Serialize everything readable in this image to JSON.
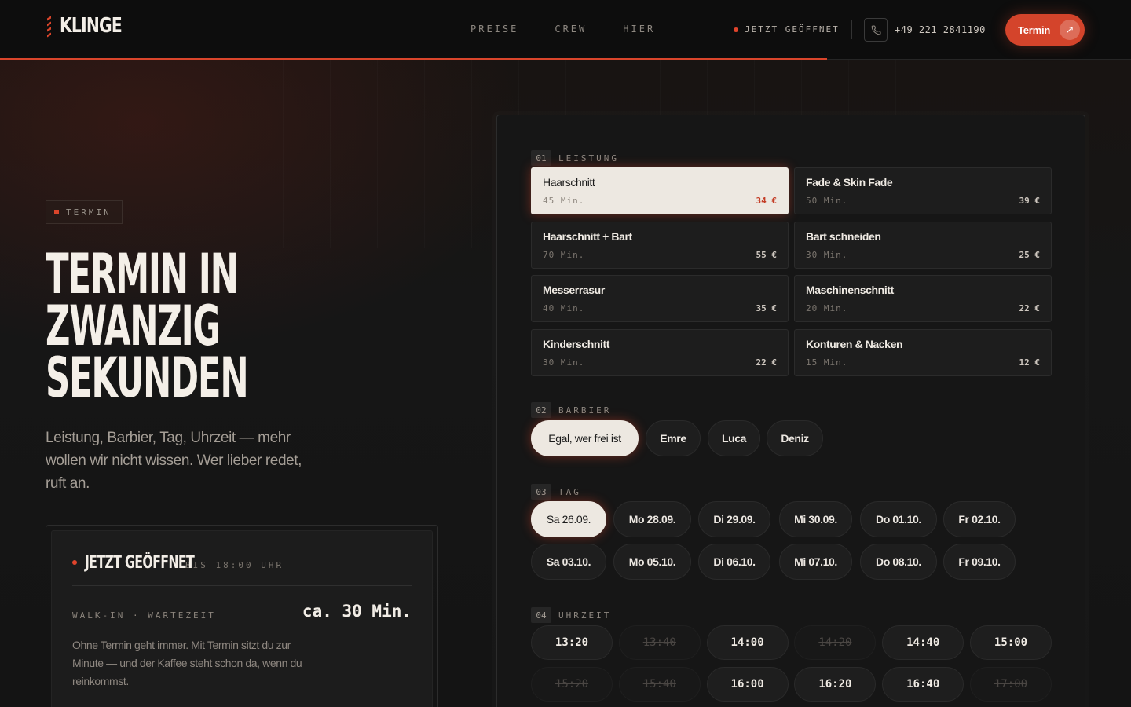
{
  "brand": {
    "name": "KLINGE"
  },
  "nav": {
    "items": [
      "PREISE",
      "CREW",
      "HIER"
    ]
  },
  "header": {
    "open_status": "JETZT GEÖFFNET",
    "phone": "+49 221 2841190",
    "cta_label": "Termin",
    "cta_arrow": "↗",
    "accent": "#d9452b"
  },
  "hero": {
    "tag": "TERMIN",
    "headline": [
      "TERMIN IN",
      "ZWANZIG",
      "SEKUNDEN"
    ],
    "lead": "Leistung, Barbier, Tag, Uhrzeit — mehr wollen wir nicht wissen. Wer lieber redet, ruft an."
  },
  "status_card": {
    "title": "JETZT GEÖFFNET",
    "until": "BIS 18:00 UHR",
    "walkin_label": "WALK-IN · WARTEZEIT",
    "wait": "ca. 30 Min.",
    "description": "Ohne Termin geht immer. Mit Termin sitzt du zur Minute — und der Kaffee steht schon da, wenn du reinkommst."
  },
  "booking": {
    "services_section": {
      "num": "01",
      "label": "LEISTUNG"
    },
    "services": [
      {
        "name": "Haarschnitt",
        "duration": "45 Min.",
        "price": "34 €",
        "selected": true
      },
      {
        "name": "Fade & Skin Fade",
        "duration": "50 Min.",
        "price": "39 €",
        "selected": false
      },
      {
        "name": "Haarschnitt + Bart",
        "duration": "70 Min.",
        "price": "55 €",
        "selected": false
      },
      {
        "name": "Bart schneiden",
        "duration": "30 Min.",
        "price": "25 €",
        "selected": false
      },
      {
        "name": "Messerrasur",
        "duration": "40 Min.",
        "price": "35 €",
        "selected": false
      },
      {
        "name": "Maschinenschnitt",
        "duration": "20 Min.",
        "price": "22 €",
        "selected": false
      },
      {
        "name": "Kinderschnitt",
        "duration": "30 Min.",
        "price": "22 €",
        "selected": false
      },
      {
        "name": "Konturen & Nacken",
        "duration": "15 Min.",
        "price": "12 €",
        "selected": false
      }
    ],
    "barber_section": {
      "num": "02",
      "label": "BARBIER"
    },
    "barbers": [
      {
        "name": "Egal, wer frei ist",
        "selected": true
      },
      {
        "name": "Emre",
        "selected": false
      },
      {
        "name": "Luca",
        "selected": false
      },
      {
        "name": "Deniz",
        "selected": false
      }
    ],
    "day_section": {
      "num": "03",
      "label": "TAG"
    },
    "days": [
      {
        "label": "Sa 26.09.",
        "selected": true
      },
      {
        "label": "Mo 28.09.",
        "selected": false
      },
      {
        "label": "Di 29.09.",
        "selected": false
      },
      {
        "label": "Mi 30.09.",
        "selected": false
      },
      {
        "label": "Do 01.10.",
        "selected": false
      },
      {
        "label": "Fr 02.10.",
        "selected": false
      },
      {
        "label": "Sa 03.10.",
        "selected": false
      },
      {
        "label": "Mo 05.10.",
        "selected": false
      },
      {
        "label": "Di 06.10.",
        "selected": false
      },
      {
        "label": "Mi 07.10.",
        "selected": false
      },
      {
        "label": "Do 08.10.",
        "selected": false
      },
      {
        "label": "Fr 09.10.",
        "selected": false
      }
    ],
    "time_section": {
      "num": "04",
      "label": "UHRZEIT"
    },
    "times": [
      {
        "label": "13:20",
        "available": true
      },
      {
        "label": "13:40",
        "available": false
      },
      {
        "label": "14:00",
        "available": true
      },
      {
        "label": "14:20",
        "available": false
      },
      {
        "label": "14:40",
        "available": true
      },
      {
        "label": "15:00",
        "available": true
      },
      {
        "label": "15:20",
        "available": false
      },
      {
        "label": "15:40",
        "available": false
      },
      {
        "label": "16:00",
        "available": true
      },
      {
        "label": "16:20",
        "available": true
      },
      {
        "label": "16:40",
        "available": true
      },
      {
        "label": "17:00",
        "available": false
      }
    ]
  },
  "icons": {
    "phone": "phone-icon",
    "arrow": "arrow-up-right-icon",
    "status_dot": "status-dot-icon"
  }
}
